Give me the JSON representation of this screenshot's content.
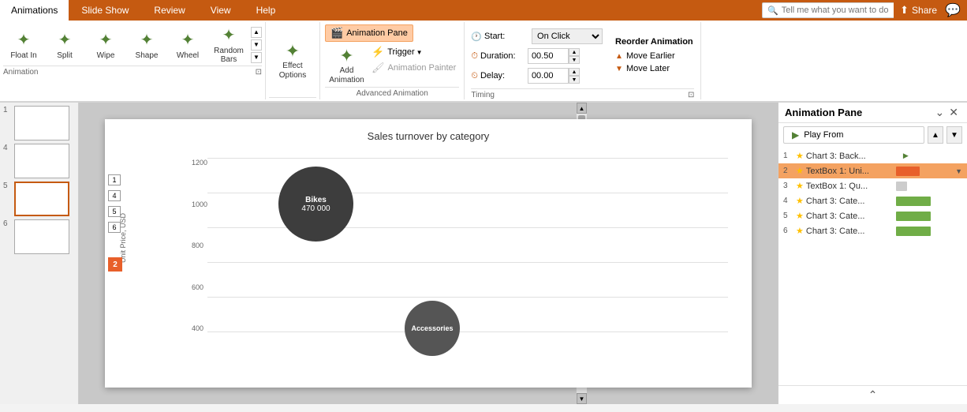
{
  "tabs": [
    {
      "label": "Animations",
      "active": true
    },
    {
      "label": "Slide Show",
      "active": false
    },
    {
      "label": "Review",
      "active": false
    },
    {
      "label": "View",
      "active": false
    },
    {
      "label": "Help",
      "active": false
    }
  ],
  "search_placeholder": "Tell me what you want to do",
  "share_label": "Share",
  "animation_group_label": "Animation",
  "animations": [
    {
      "label": "Float In",
      "icon": "✦"
    },
    {
      "label": "Split",
      "icon": "✦"
    },
    {
      "label": "Wipe",
      "icon": "✦"
    },
    {
      "label": "Shape",
      "icon": "✦"
    },
    {
      "label": "Wheel",
      "icon": "✦"
    },
    {
      "label": "Random Bars",
      "icon": "✦"
    }
  ],
  "effect_options_label": "Effect\nOptions",
  "add_animation_label": "Add\nAnimation",
  "advanced_animation_label": "Advanced Animation",
  "animation_pane_btn": "Animation Pane",
  "trigger_btn": "Trigger",
  "animation_painter_btn": "Animation Painter",
  "timing_label": "Timing",
  "start_label": "Start:",
  "start_value": "On Click",
  "duration_label": "Duration:",
  "duration_value": "00.50",
  "delay_label": "Delay:",
  "delay_value": "00.00",
  "reorder_animation_label": "Reorder Animation",
  "move_earlier_label": "Move Earlier",
  "move_later_label": "Move Later",
  "anim_pane": {
    "title": "Animation Pane",
    "play_from_label": "Play From",
    "items": [
      {
        "num": "1",
        "star": true,
        "name": "Chart 3: Back...",
        "bar_type": "none",
        "play_icon": true,
        "selected": false
      },
      {
        "num": "2",
        "star": true,
        "name": "TextBox 1: Uni...",
        "bar_type": "orange",
        "play_icon": false,
        "selected": true
      },
      {
        "num": "3",
        "star": true,
        "name": "TextBox 1: Qu...",
        "bar_type": "small",
        "play_icon": false,
        "selected": false
      },
      {
        "num": "4",
        "star": true,
        "name": "Chart 3: Cate...",
        "bar_type": "green",
        "play_icon": false,
        "selected": false
      },
      {
        "num": "5",
        "star": true,
        "name": "Chart 3: Cate...",
        "bar_type": "green",
        "play_icon": false,
        "selected": false
      },
      {
        "num": "6",
        "star": true,
        "name": "Chart 3: Cate...",
        "bar_type": "green",
        "play_icon": false,
        "selected": false
      }
    ]
  },
  "slide": {
    "title": "Sales turnover by category",
    "y_axis_label": "Unit Price, USD",
    "y_ticks": [
      "400",
      "600",
      "800",
      "1000",
      "1200"
    ],
    "bubbles": [
      {
        "label": "Bikes",
        "value": "470 000",
        "x": 270,
        "y": 60,
        "size": 95
      },
      {
        "label": "Accessories",
        "value": "",
        "x": 415,
        "y": 220,
        "size": 65
      }
    ],
    "slide_numbers": [
      "1",
      "4",
      "5",
      "6"
    ],
    "indicator": "2"
  }
}
